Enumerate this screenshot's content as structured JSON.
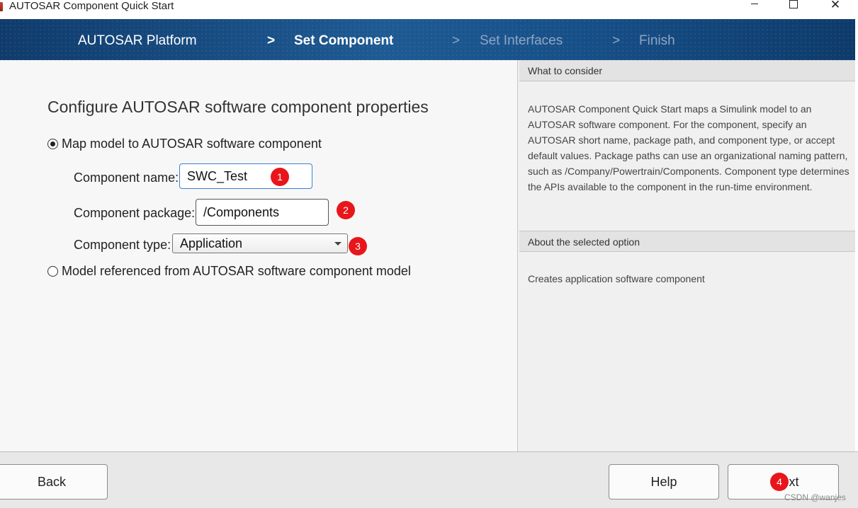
{
  "window": {
    "title": "AUTOSAR Component Quick Start",
    "controls": {
      "minimize": "—",
      "maximize": "☐",
      "close": "✕"
    }
  },
  "wizard": {
    "steps": [
      {
        "label": "AUTOSAR Platform",
        "state": "done"
      },
      {
        "label": "Set Component",
        "state": "active"
      },
      {
        "label": "Set Interfaces",
        "state": "future"
      },
      {
        "label": "Finish",
        "state": "future"
      }
    ],
    "separator": ">"
  },
  "main": {
    "heading": "Configure AUTOSAR software component properties",
    "options": [
      {
        "label": "Map model to AUTOSAR software component",
        "selected": true
      },
      {
        "label": "Model referenced from AUTOSAR software component model",
        "selected": false
      }
    ],
    "fields": {
      "component_name": {
        "label": "Component name:",
        "value": "SWC_Test"
      },
      "component_package": {
        "label": "Component package:",
        "value": "/Components"
      },
      "component_type": {
        "label": "Component type:",
        "value": "Application"
      }
    }
  },
  "side": {
    "consider_header": "What to consider",
    "consider_text": "AUTOSAR Component Quick Start maps a Simulink model to an AUTOSAR software component. For the component, specify an AUTOSAR short name, package path, and component type, or accept default values. Package paths can use an organizational naming pattern, such as /Company/Powertrain/Components. Component type determines the APIs available to the component in the run-time environment.",
    "selected_header": "About the selected option",
    "selected_text": "Creates application software component"
  },
  "footer": {
    "back_label": "Back",
    "help_label": "Help",
    "next_label": "xt"
  },
  "annotations": [
    "1",
    "2",
    "3",
    "4"
  ],
  "watermark": "CSDN @wanjes",
  "colors": {
    "banner": "#1e5a93",
    "badge": "#e8161b",
    "focus": "#3b7fd4"
  }
}
